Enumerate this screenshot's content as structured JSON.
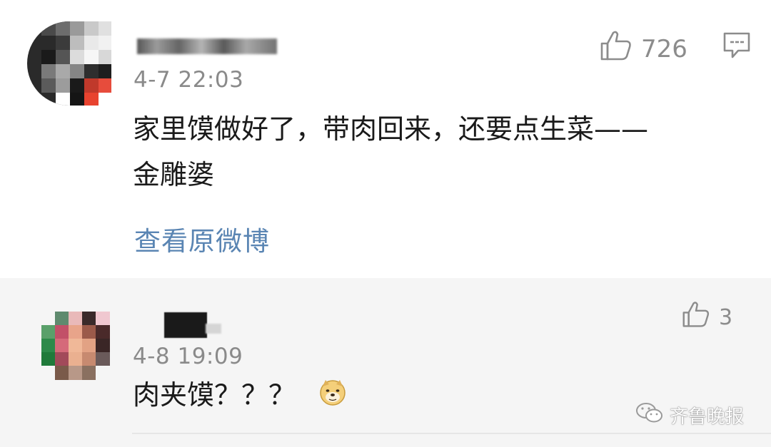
{
  "main_comment": {
    "timestamp": "4-7 22:03",
    "text_line1": "家里馍做好了，带肉回来，还要点生菜——",
    "text_line2": "金雕婆",
    "view_original_label": "查看原微博",
    "likes": "726"
  },
  "reply": {
    "timestamp": "4-8 19:09",
    "text": "肉夹馍？？？",
    "likes": "3",
    "emoji_icon": "doge-emoji-icon"
  },
  "watermark": {
    "text": "齐鲁晚报"
  },
  "colors": {
    "link": "#5a85b3",
    "meta_gray": "#8a8a8a",
    "reply_bg": "#f5f5f5"
  }
}
